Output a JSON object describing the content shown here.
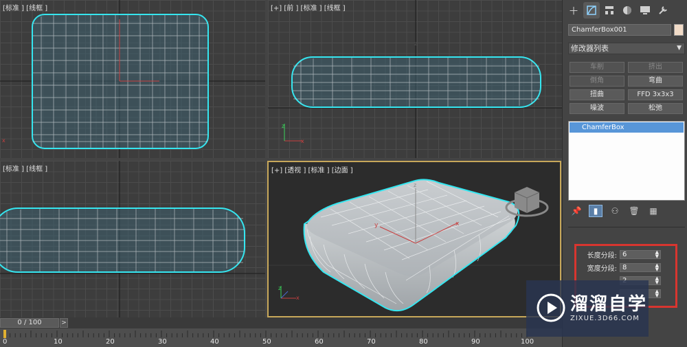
{
  "viewports": {
    "top": {
      "label_plus": "",
      "label_view": "[标准 ]",
      "label_shade": "[线框 ]"
    },
    "front": {
      "label_plus": "[+]",
      "label_view": "[前 ]",
      "label_std": "[标准 ]",
      "label_shade": "[线框 ]"
    },
    "left": {
      "label_view": "[标准 ]",
      "label_shade": "[线框 ]"
    },
    "persp": {
      "label_plus": "[+]",
      "label_view": "[透视 ]",
      "label_std": "[标准 ]",
      "label_shade": "[边面 ]"
    }
  },
  "panel": {
    "tabs": [
      "create-icon",
      "modify-icon",
      "hierarchy-icon",
      "motion-icon",
      "display-icon",
      "utilities-icon"
    ],
    "object_name": "ChamferBox001",
    "object_color": "#f2dcc8",
    "modifier_list": "修改器列表",
    "buttons": {
      "lathe": "车削",
      "extrude": "挤出",
      "chamfer": "倒角",
      "bend": "弯曲",
      "twist": "扭曲",
      "ffd": "FFD 3x3x3",
      "noise": "噪波",
      "relax": "松弛"
    },
    "stack_item": "ChamferBox",
    "params": {
      "length_segs_label": "长度分段:",
      "length_segs_value": "6",
      "width_segs_label": "宽度分段:",
      "width_segs_value": "8",
      "height_segs_value": "2"
    }
  },
  "timeline": {
    "slider_value": "0 / 100",
    "next_label": ">",
    "ticks": [
      "0",
      "10",
      "20",
      "30",
      "40",
      "50",
      "60",
      "70",
      "80",
      "90",
      "100"
    ]
  },
  "watermark": {
    "title": "溜溜自学",
    "url": "ZIXUE.3D66.COM"
  },
  "colors": {
    "wire_cyan": "#35e6f0",
    "highlight_red": "#d8352f",
    "active_viewport": "#c8a85a"
  }
}
